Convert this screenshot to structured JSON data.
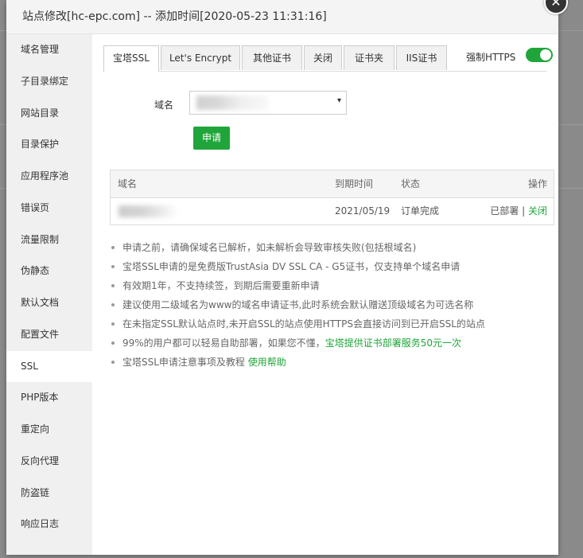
{
  "dialog": {
    "title": "站点修改[hc-epc.com] -- 添加时间[2020-05-23 11:31:16]",
    "close_glyph": "✕"
  },
  "sidebar": {
    "items": [
      {
        "label": "域名管理"
      },
      {
        "label": "子目录绑定"
      },
      {
        "label": "网站目录"
      },
      {
        "label": "目录保护"
      },
      {
        "label": "应用程序池"
      },
      {
        "label": "错误页"
      },
      {
        "label": "流量限制"
      },
      {
        "label": "伪静态"
      },
      {
        "label": "默认文档"
      },
      {
        "label": "配置文件"
      },
      {
        "label": "SSL",
        "active": true
      },
      {
        "label": "PHP版本"
      },
      {
        "label": "重定向"
      },
      {
        "label": "反向代理"
      },
      {
        "label": "防盗链"
      },
      {
        "label": "响应日志"
      }
    ]
  },
  "tabs": [
    {
      "label": "宝塔SSL",
      "active": true
    },
    {
      "label": "Let's Encrypt"
    },
    {
      "label": "其他证书"
    },
    {
      "label": "关闭"
    },
    {
      "label": "证书夹"
    },
    {
      "label": "IIS证书"
    }
  ],
  "force_https": {
    "label": "强制HTTPS",
    "enabled": true
  },
  "form": {
    "domain_label": "域名",
    "select_caret": "▾",
    "apply_label": "申请"
  },
  "table": {
    "headers": {
      "domain": "域名",
      "expire": "到期时间",
      "status": "状态",
      "action": "操作"
    },
    "rows": [
      {
        "expire": "2021/05/19",
        "status": "订单完成",
        "deployed": "已部署",
        "separator": "|",
        "close": "关闭"
      }
    ]
  },
  "tips": [
    {
      "text": "申请之前，请确保域名已解析，如未解析会导致审核失败(包括根域名)"
    },
    {
      "text": "宝塔SSL申请的是免费版TrustAsia DV SSL CA - G5证书，仅支持单个域名申请"
    },
    {
      "text": "有效期1年，不支持续签，到期后需要重新申请"
    },
    {
      "text": "建议使用二级域名为www的域名申请证书,此时系统会默认赠送顶级域名为可选名称"
    },
    {
      "text": "在未指定SSL默认站点时,未开启SSL的站点使用HTTPS会直接访问到已开启SSL的站点"
    },
    {
      "text": "99%的用户都可以轻易自助部署，如果您不懂，",
      "link": "宝塔提供证书部署服务50元一次"
    },
    {
      "text": "宝塔SSL申请注意事项及教程 ",
      "link": "使用帮助"
    }
  ],
  "colors": {
    "accent": "#20a53a",
    "sidebar_bg": "#f0f0f0",
    "titlebar_bg": "#f4f4f4"
  }
}
